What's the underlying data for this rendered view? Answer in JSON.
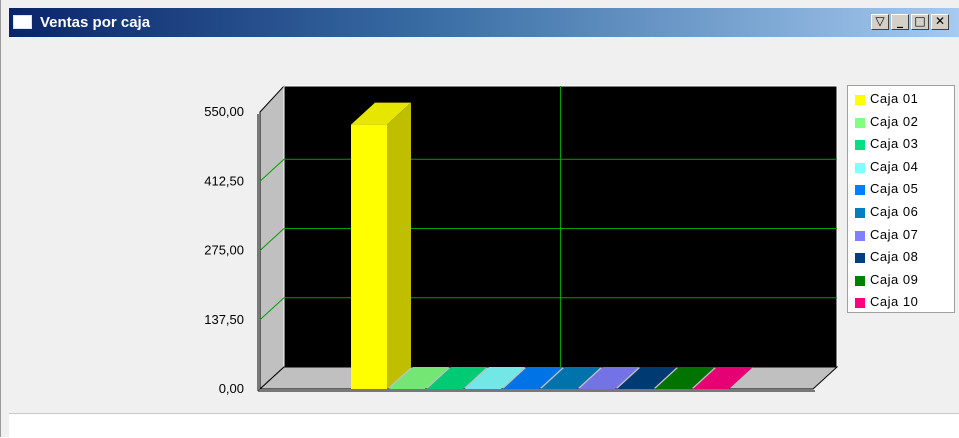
{
  "window": {
    "title": "Ventas por caja",
    "buttons": [
      "▽",
      "_",
      "□",
      "✕"
    ]
  },
  "chart_data": {
    "type": "bar",
    "title": "",
    "xlabel": "",
    "ylabel": "",
    "ylim": [
      0,
      550
    ],
    "yticks": [
      "0,00",
      "137,50",
      "275,00",
      "412,50",
      "550,00"
    ],
    "grid": true,
    "legend_position": "right",
    "three_d": true,
    "series": [
      {
        "name": "Caja 01",
        "value": 525,
        "color": "#ffff00"
      },
      {
        "name": "Caja 02",
        "value": 0,
        "color": "#80ff80"
      },
      {
        "name": "Caja 03",
        "value": 0,
        "color": "#00e080"
      },
      {
        "name": "Caja 04",
        "value": 0,
        "color": "#80ffff"
      },
      {
        "name": "Caja 05",
        "value": 0,
        "color": "#0080ff"
      },
      {
        "name": "Caja 06",
        "value": 0,
        "color": "#0080c0"
      },
      {
        "name": "Caja 07",
        "value": 0,
        "color": "#8080ff"
      },
      {
        "name": "Caja 08",
        "value": 0,
        "color": "#004080"
      },
      {
        "name": "Caja 09",
        "value": 0,
        "color": "#008000"
      },
      {
        "name": "Caja 10",
        "value": 0,
        "color": "#ff0080"
      }
    ]
  }
}
